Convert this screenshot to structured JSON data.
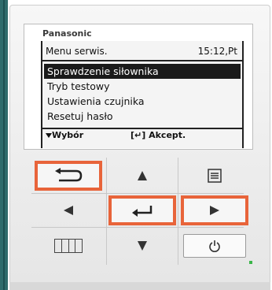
{
  "brand": "Panasonic",
  "screen": {
    "title": "Menu serwis.",
    "clock": "15:12,Pt",
    "menu_items": [
      {
        "label": "Sprawdzenie siłownika",
        "selected": true
      },
      {
        "label": "Tryb testowy",
        "selected": false
      },
      {
        "label": "Ustawienia czujnika",
        "selected": false
      },
      {
        "label": "Resetuj hasło",
        "selected": false
      }
    ],
    "footer": {
      "select_hint": "Wybór",
      "confirm_hint": "[↵] Akcept."
    }
  },
  "buttons": {
    "return": {
      "icon": "return-icon",
      "highlighted": true
    },
    "up": {
      "icon": "up-triangle-icon",
      "highlighted": false
    },
    "menu": {
      "icon": "list-icon",
      "highlighted": false
    },
    "left": {
      "icon": "left-triangle-icon",
      "highlighted": false
    },
    "enter": {
      "icon": "enter-icon",
      "highlighted": true
    },
    "right": {
      "icon": "right-triangle-icon",
      "highlighted": true
    },
    "grid": {
      "icon": "grid-icon",
      "highlighted": false
    },
    "down": {
      "icon": "down-triangle-icon",
      "highlighted": false
    },
    "power": {
      "icon": "power-icon",
      "highlighted": false
    }
  },
  "colors": {
    "highlight": "#e8643a",
    "led": "#3bb54a"
  }
}
